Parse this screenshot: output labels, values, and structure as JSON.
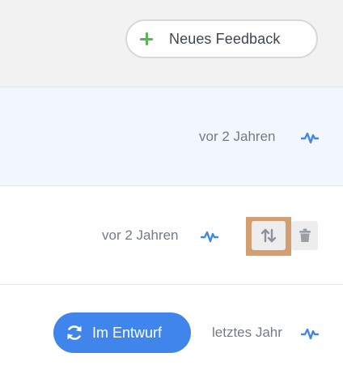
{
  "header": {
    "new_feedback_label": "Neues Feedback",
    "plus_icon": "plus-icon"
  },
  "rows": [
    {
      "time": "vor 2 Jahren",
      "activity_icon": "activity-icon"
    },
    {
      "time": "vor 2 Jahren",
      "activity_icon": "activity-icon",
      "actions": [
        "sort-icon",
        "trash-icon"
      ]
    },
    {
      "status_badge": "Im Entwurf",
      "status_icon": "refresh-icon",
      "time": "letztes Jahr",
      "activity_icon": "activity-icon"
    }
  ],
  "colors": {
    "accent_blue": "#3f85ec",
    "plus_green": "#5ab553",
    "highlight": "#d39f71",
    "selected_row_bg": "#f2f6fd"
  }
}
